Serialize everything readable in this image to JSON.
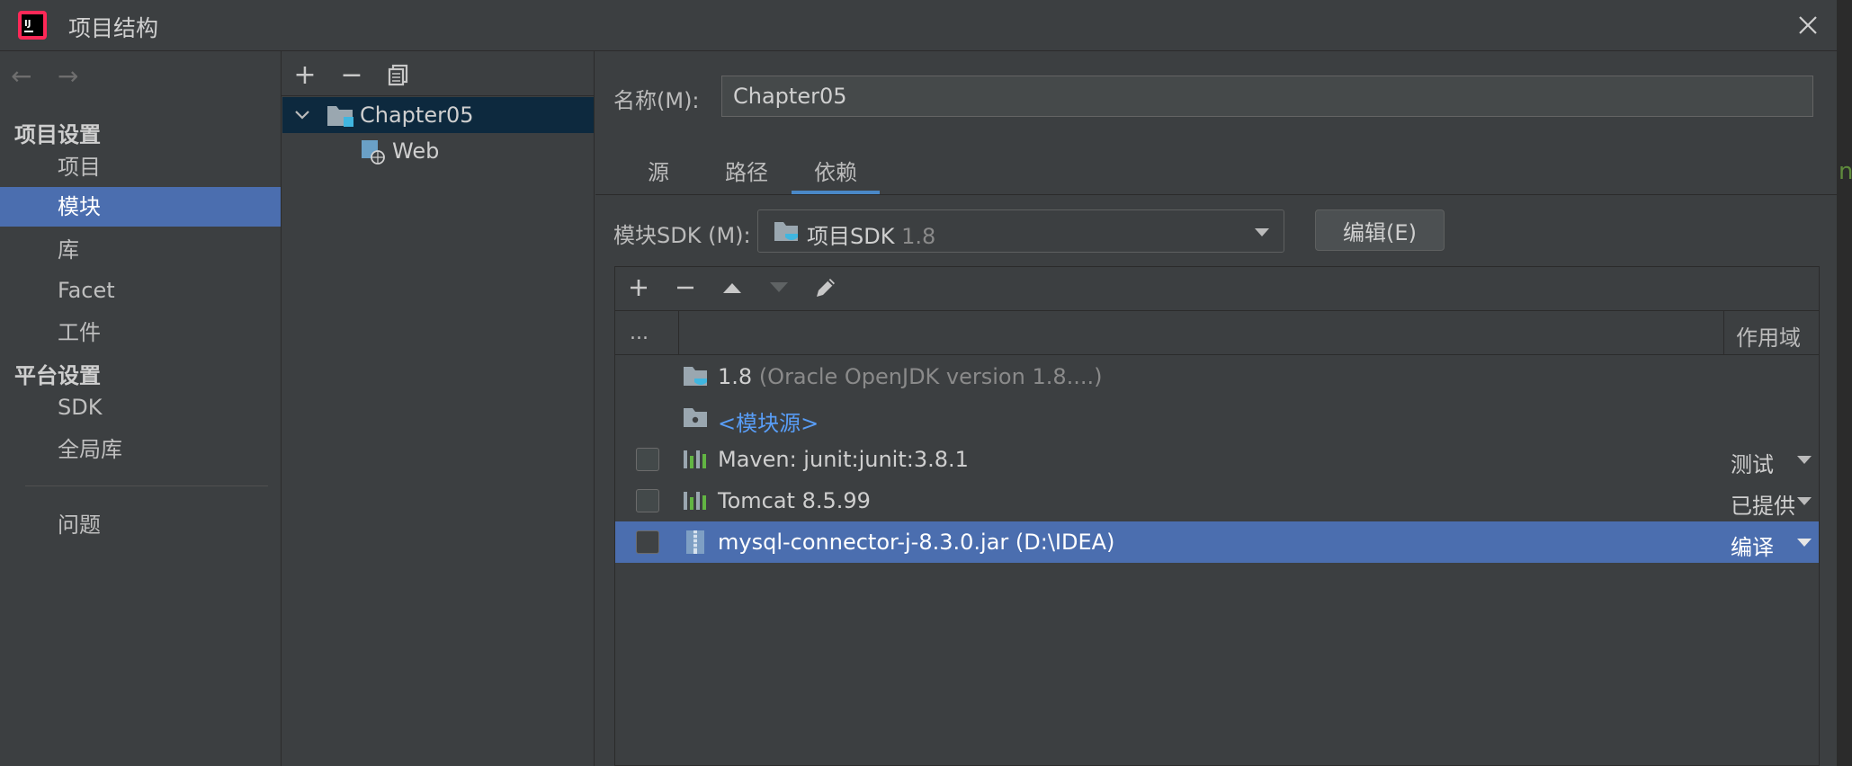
{
  "window": {
    "title": "项目结构"
  },
  "nav": {
    "back_arrow": "←",
    "forward_arrow": "→",
    "section_project": "项目设置",
    "items_project": [
      "项目",
      "模块",
      "库",
      "Facet",
      "工件"
    ],
    "selected_item": "模块",
    "section_platform": "平台设置",
    "items_platform": [
      "SDK",
      "全局库"
    ],
    "problems": "问题"
  },
  "tree": {
    "toolbar": {
      "add": "+",
      "remove": "−"
    },
    "module": "Chapter05",
    "facet": "Web"
  },
  "module": {
    "name_label": "名称(M):",
    "name_value": "Chapter05",
    "tabs": [
      "源",
      "路径",
      "依赖"
    ],
    "active_tab": "依赖",
    "sdk_label": "模块SDK (M):",
    "sdk_name": "项目SDK",
    "sdk_version": "1.8",
    "edit_button": "编辑(E)"
  },
  "dependencies": {
    "header_dots": "...",
    "header_scope": "作用域",
    "rows": [
      {
        "name": "1.8",
        "detail": "(Oracle OpenJDK version 1.8....)",
        "type": "jdk"
      },
      {
        "name": "<模块源>",
        "type": "module-source"
      },
      {
        "name": "Maven: junit:junit:3.8.1",
        "scope": "测试",
        "type": "library",
        "checked": false
      },
      {
        "name": "Tomcat 8.5.99",
        "scope": "已提供",
        "type": "library",
        "checked": false
      },
      {
        "name": "mysql-connector-j-8.3.0.jar (D:\\IDEA)",
        "scope": "编译",
        "type": "jar",
        "checked": false,
        "selected": true
      }
    ]
  },
  "edge_glyph": "n",
  "colors": {
    "background": "#3c3f41",
    "selection": "#4b6eaf",
    "tree_selection": "#0d293e",
    "accent": "#4a88c7",
    "link": "#589df6"
  }
}
